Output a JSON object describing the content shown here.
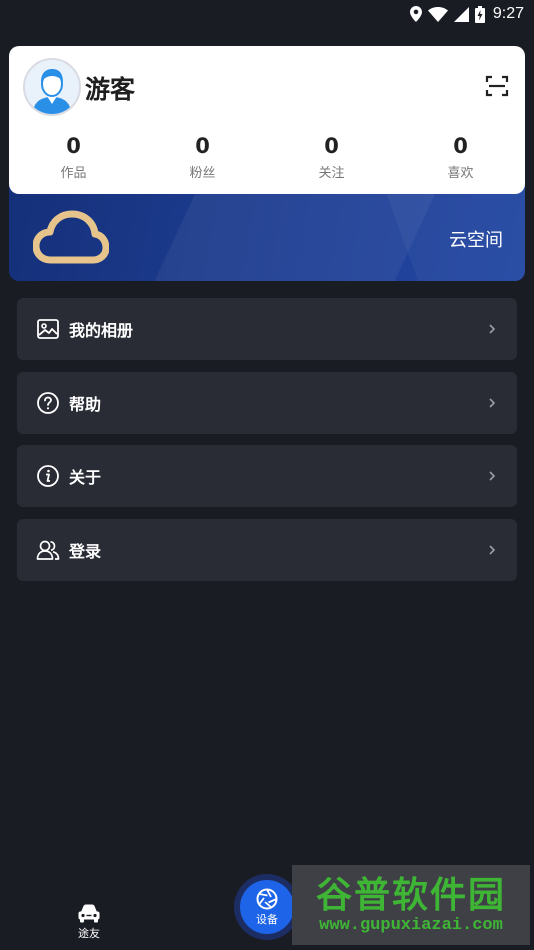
{
  "status_bar": {
    "time": "9:27"
  },
  "profile": {
    "username": "游客",
    "stats": [
      {
        "value": "0",
        "label": "作品"
      },
      {
        "value": "0",
        "label": "粉丝"
      },
      {
        "value": "0",
        "label": "关注"
      },
      {
        "value": "0",
        "label": "喜欢"
      }
    ]
  },
  "cloud": {
    "label": "云空间"
  },
  "menu": [
    {
      "label": "我的相册",
      "icon": "image-icon"
    },
    {
      "label": "帮助",
      "icon": "help-icon"
    },
    {
      "label": "关于",
      "icon": "info-icon"
    },
    {
      "label": "登录",
      "icon": "users-icon"
    }
  ],
  "bottom_nav": {
    "left_label": "途友",
    "center_label": "设备"
  },
  "watermark": {
    "title": "谷普软件园",
    "url": "www.gupuxiazai.com"
  },
  "colors": {
    "background": "#1a1c24",
    "card": "#ffffff",
    "menu_item": "#292b35",
    "cloud_gold": "#e6c48c",
    "accent_blue": "#1d64e8"
  }
}
